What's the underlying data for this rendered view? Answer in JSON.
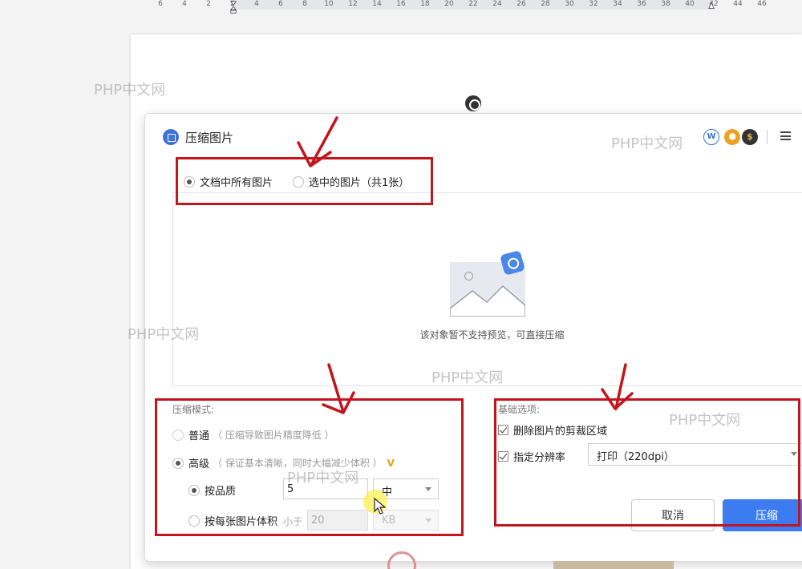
{
  "ruler": {
    "ticks": [
      "6",
      "4",
      "2",
      "2",
      "4",
      "6",
      "8",
      "10",
      "12",
      "14",
      "16",
      "18",
      "20",
      "22",
      "24",
      "26",
      "28",
      "30",
      "32",
      "34",
      "36",
      "38",
      "40",
      "42",
      "44",
      "46"
    ]
  },
  "dialog": {
    "title": "压缩图片",
    "scope": {
      "all_images": "文档中所有图片",
      "selected_images": "选中的图片（共1张）",
      "selected": "all_images"
    },
    "preview": {
      "message": "该对象暂不支持预览，可直接压缩"
    },
    "compression_mode": {
      "section_title": "压缩模式:",
      "normal_label": "普通",
      "normal_hint": "（ 压缩导致图片精度降低 ）",
      "advanced_label": "高级",
      "advanced_hint": "（ 保证基本清晰，同时大幅减少体积 ）",
      "vip_mark": "V",
      "by_quality_label": "按品质",
      "quality_value": "5",
      "quality_level": "中",
      "by_size_label": "按每张图片体积",
      "less_than": "小于",
      "size_value": "20",
      "size_unit": "KB"
    },
    "basic_options": {
      "section_title": "基础选项:",
      "remove_crop_label": "删除图片的剪裁区域",
      "remove_crop_checked": true,
      "set_resolution_label": "指定分辨率",
      "set_resolution_checked": true,
      "resolution_value": "打印（220dpi）"
    },
    "buttons": {
      "cancel": "取消",
      "compress": "压缩"
    }
  },
  "watermark_text": "PHP中文网",
  "colors": {
    "annotation": "#c4141c",
    "primary_button": "#3b7cf0",
    "vip": "#e0a020"
  }
}
